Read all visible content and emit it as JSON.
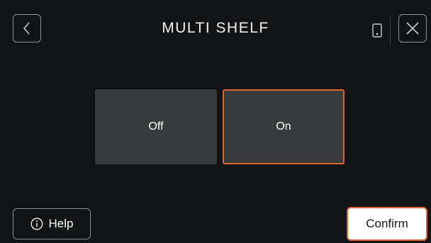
{
  "header": {
    "title": "MULTI SHELF",
    "back_icon": "chevron-left-icon",
    "device_icon": "phone-icon",
    "close_icon": "close-icon"
  },
  "options": {
    "items": [
      {
        "label": "Off",
        "selected": false
      },
      {
        "label": "On",
        "selected": true
      }
    ]
  },
  "footer": {
    "help_label": "Help",
    "help_icon": "info-icon",
    "confirm_label": "Confirm"
  },
  "colors": {
    "background": "#111314",
    "option_bg": "#383b3c",
    "accent": "#e0642e",
    "outline": "#8e9193"
  }
}
